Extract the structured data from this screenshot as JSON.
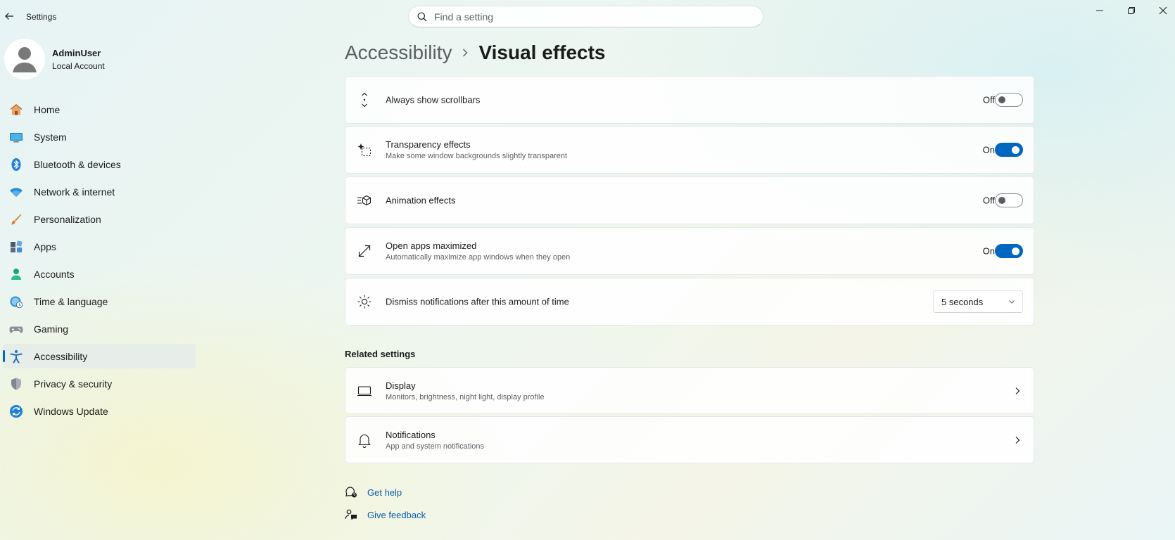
{
  "window": {
    "app_title": "Settings",
    "search_placeholder": "Find a setting"
  },
  "profile": {
    "name": "AdminUser",
    "account_type": "Local Account"
  },
  "sidebar": {
    "items": [
      {
        "label": "Home",
        "icon": "home-icon"
      },
      {
        "label": "System",
        "icon": "system-icon"
      },
      {
        "label": "Bluetooth & devices",
        "icon": "bluetooth-icon"
      },
      {
        "label": "Network & internet",
        "icon": "wifi-icon"
      },
      {
        "label": "Personalization",
        "icon": "brush-icon"
      },
      {
        "label": "Apps",
        "icon": "apps-icon"
      },
      {
        "label": "Accounts",
        "icon": "accounts-icon"
      },
      {
        "label": "Time & language",
        "icon": "time-language-icon"
      },
      {
        "label": "Gaming",
        "icon": "gaming-icon"
      },
      {
        "label": "Accessibility",
        "icon": "accessibility-icon",
        "active": true
      },
      {
        "label": "Privacy & security",
        "icon": "shield-icon"
      },
      {
        "label": "Windows Update",
        "icon": "update-icon"
      }
    ]
  },
  "breadcrumb": {
    "parent": "Accessibility",
    "current": "Visual effects"
  },
  "settings": {
    "scrollbars": {
      "title": "Always show scrollbars",
      "state": "Off",
      "enabled": false
    },
    "transparency": {
      "title": "Transparency effects",
      "description": "Make some window backgrounds slightly transparent",
      "state": "On",
      "enabled": true
    },
    "animation": {
      "title": "Animation effects",
      "state": "Off",
      "enabled": false
    },
    "open_maximized": {
      "title": "Open apps maximized",
      "description": "Automatically maximize app windows when they open",
      "state": "On",
      "enabled": true
    },
    "dismiss_notifications": {
      "title": "Dismiss notifications after this amount of time",
      "value": "5 seconds"
    }
  },
  "related": {
    "heading": "Related settings",
    "display": {
      "title": "Display",
      "description": "Monitors, brightness, night light, display profile"
    },
    "notifications": {
      "title": "Notifications",
      "description": "App and system notifications"
    }
  },
  "help": {
    "get_help": "Get help",
    "give_feedback": "Give feedback"
  },
  "colors": {
    "accent": "#0067c0",
    "link": "#0b5cad"
  }
}
